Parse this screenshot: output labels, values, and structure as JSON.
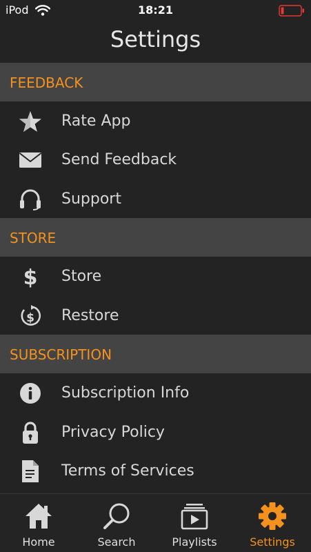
{
  "status_bar": {
    "carrier": "iPod",
    "time": "18:21",
    "wifi_icon": "wifi-icon",
    "battery_icon": "battery-low-icon",
    "battery_color": "#e53935"
  },
  "nav": {
    "title": "Settings"
  },
  "colors": {
    "accent": "#f5921e",
    "background": "#232323",
    "section_bg": "#444444"
  },
  "sections": [
    {
      "title": "FEEDBACK",
      "items": [
        {
          "label": "Rate App",
          "icon": "star-icon"
        },
        {
          "label": "Send Feedback",
          "icon": "envelope-icon"
        },
        {
          "label": "Support",
          "icon": "headphones-icon"
        }
      ]
    },
    {
      "title": "STORE",
      "items": [
        {
          "label": "Store",
          "icon": "dollar-icon"
        },
        {
          "label": "Restore",
          "icon": "restore-dollar-icon"
        }
      ]
    },
    {
      "title": "SUBSCRIPTION",
      "items": [
        {
          "label": "Subscription Info",
          "icon": "info-icon"
        },
        {
          "label": "Privacy Policy",
          "icon": "lock-icon"
        },
        {
          "label": "Terms of Services",
          "icon": "document-icon"
        }
      ]
    }
  ],
  "tabs": [
    {
      "label": "Home",
      "icon": "home-icon",
      "active": false
    },
    {
      "label": "Search",
      "icon": "search-icon",
      "active": false
    },
    {
      "label": "Playlists",
      "icon": "playlists-icon",
      "active": false
    },
    {
      "label": "Settings",
      "icon": "gear-icon",
      "active": true
    }
  ]
}
